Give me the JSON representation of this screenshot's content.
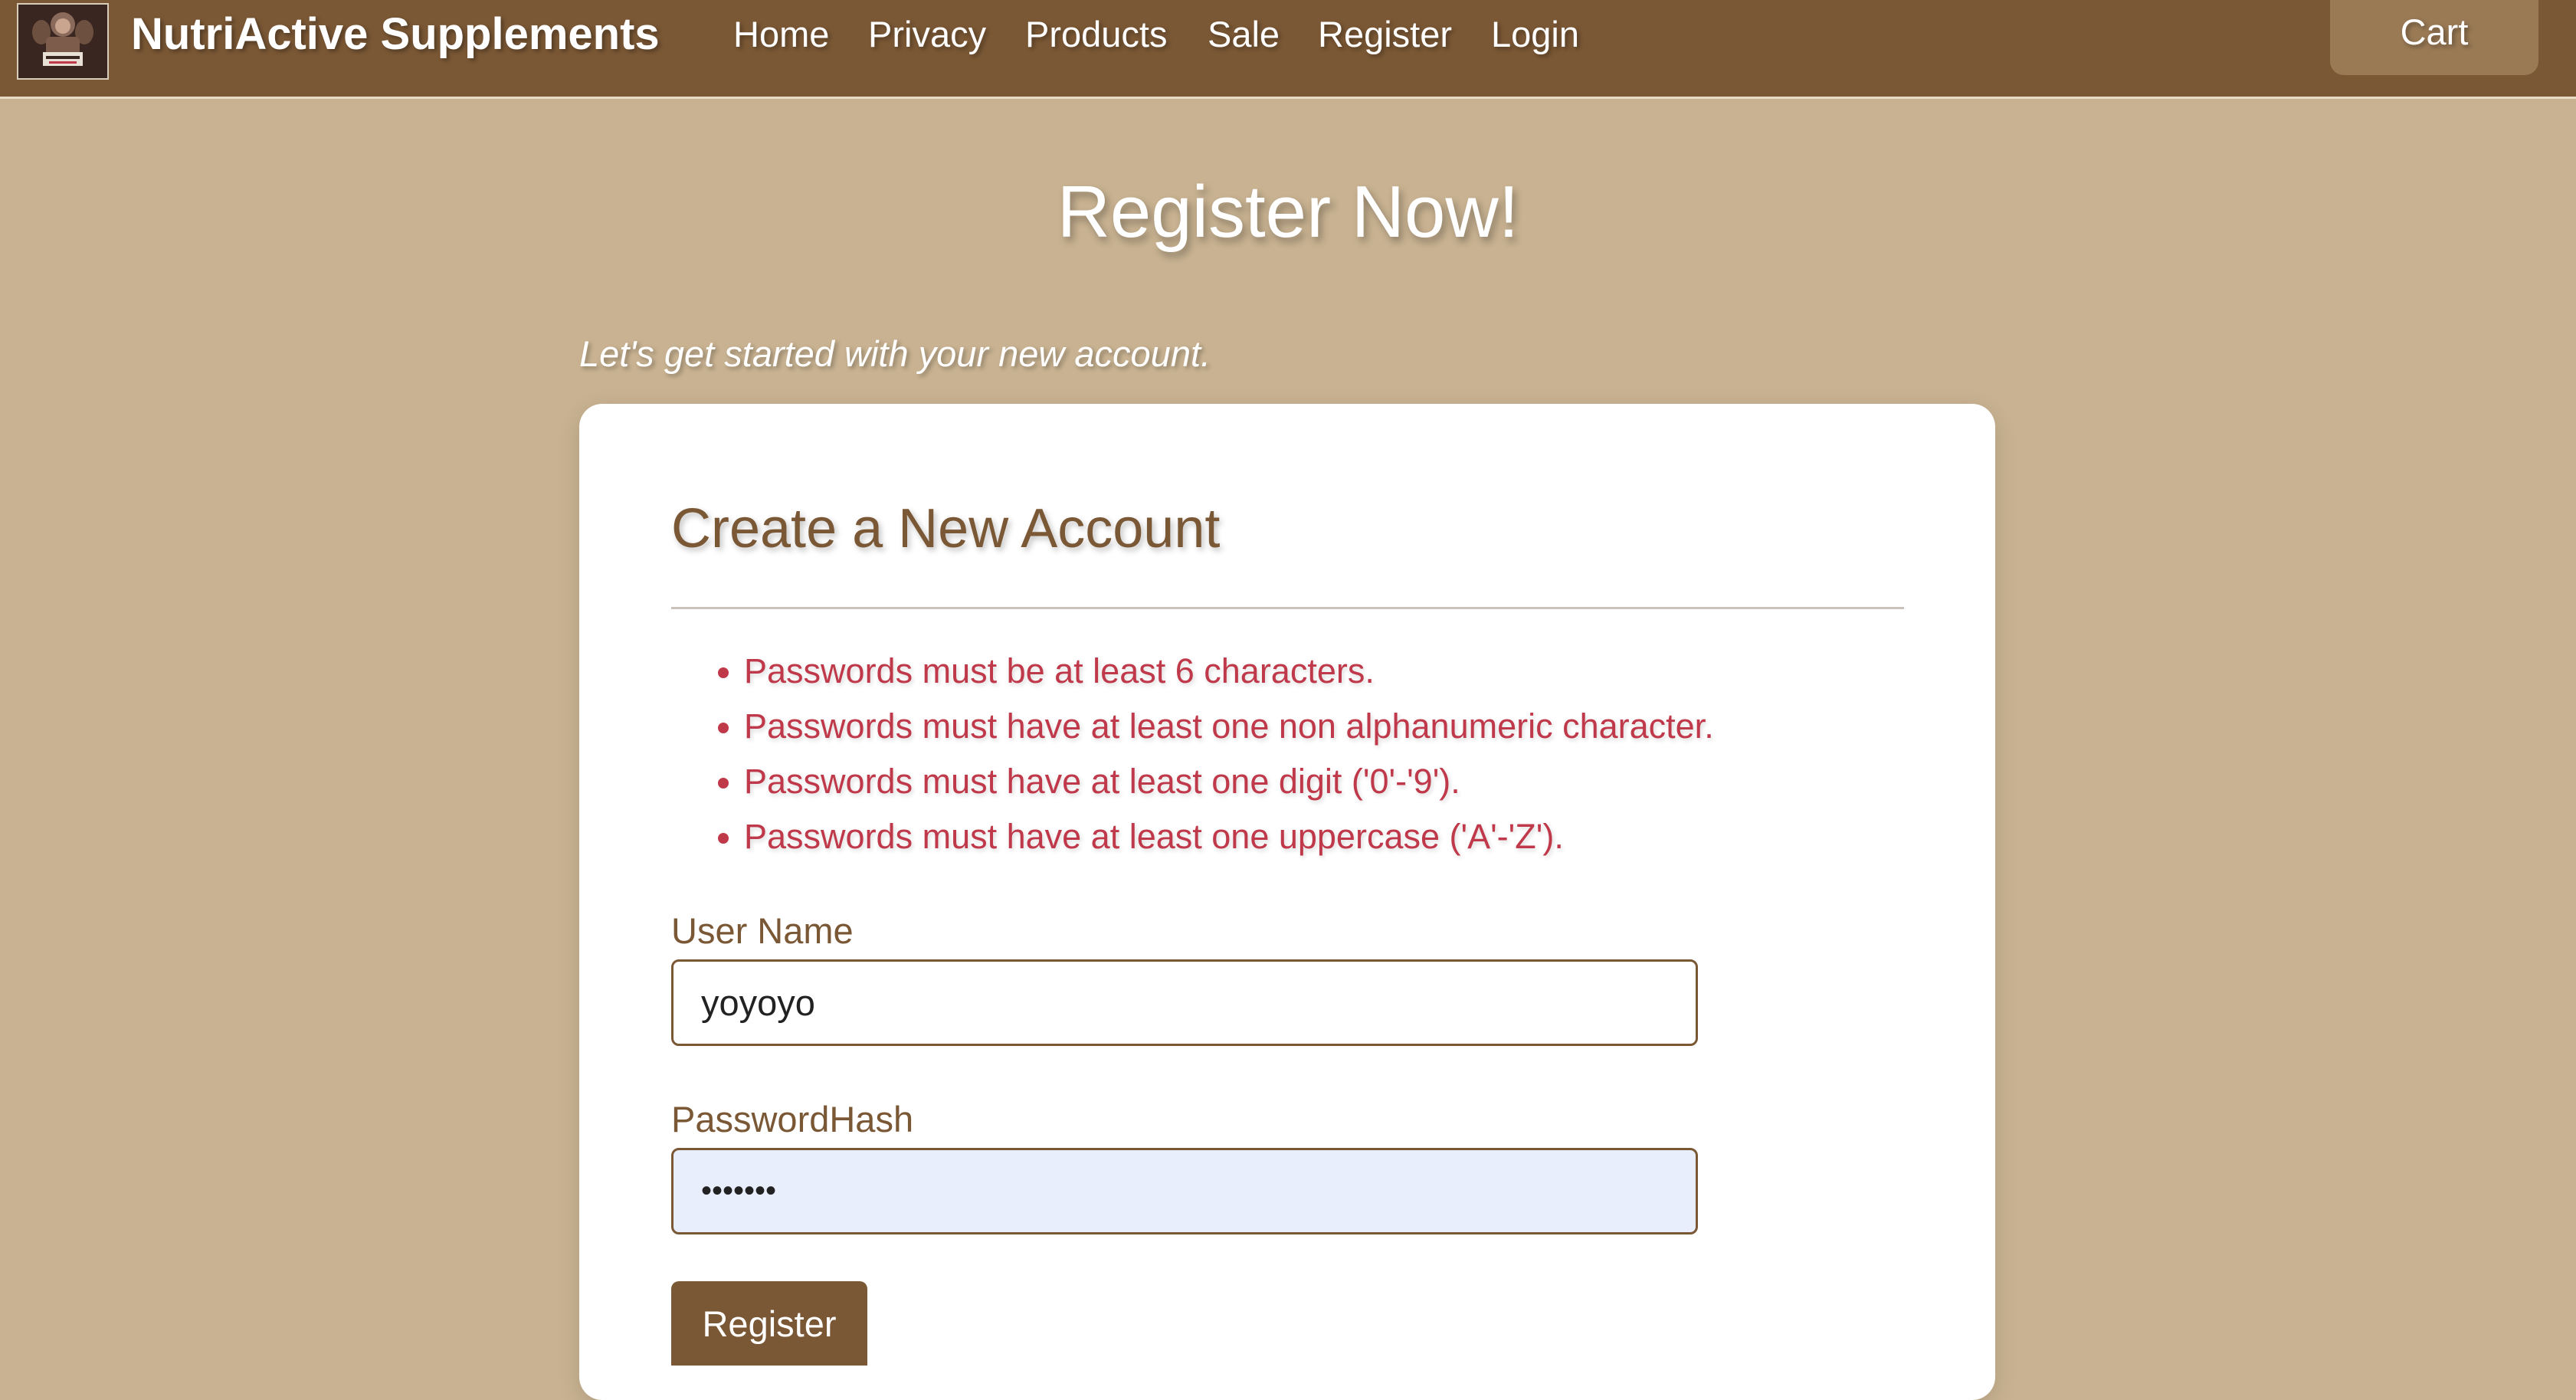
{
  "navbar": {
    "logo_icon": "gorilla-mascot-logo",
    "brand": "NutriActive Supplements",
    "links": [
      {
        "label": "Home"
      },
      {
        "label": "Privacy"
      },
      {
        "label": "Products"
      },
      {
        "label": "Sale"
      },
      {
        "label": "Register"
      },
      {
        "label": "Login"
      }
    ],
    "cart_label": "Cart"
  },
  "page": {
    "title": "Register Now!",
    "tagline": "Let's get started with your new account."
  },
  "form": {
    "title": "Create a New Account",
    "errors": [
      "Passwords must be at least 6 characters.",
      "Passwords must have at least one non alphanumeric character.",
      "Passwords must have at least one digit ('0'-'9').",
      "Passwords must have at least one uppercase ('A'-'Z')."
    ],
    "username": {
      "label": "User Name",
      "value": "yoyoyo"
    },
    "password": {
      "label": "PasswordHash",
      "value": "•••••••"
    },
    "submit_label": "Register"
  },
  "colors": {
    "page_bg": "#c8b291",
    "navbar_bg": "#7b5835",
    "accent": "#7b5835",
    "error": "#c0394a",
    "autofill_bg": "#e8eefb"
  }
}
